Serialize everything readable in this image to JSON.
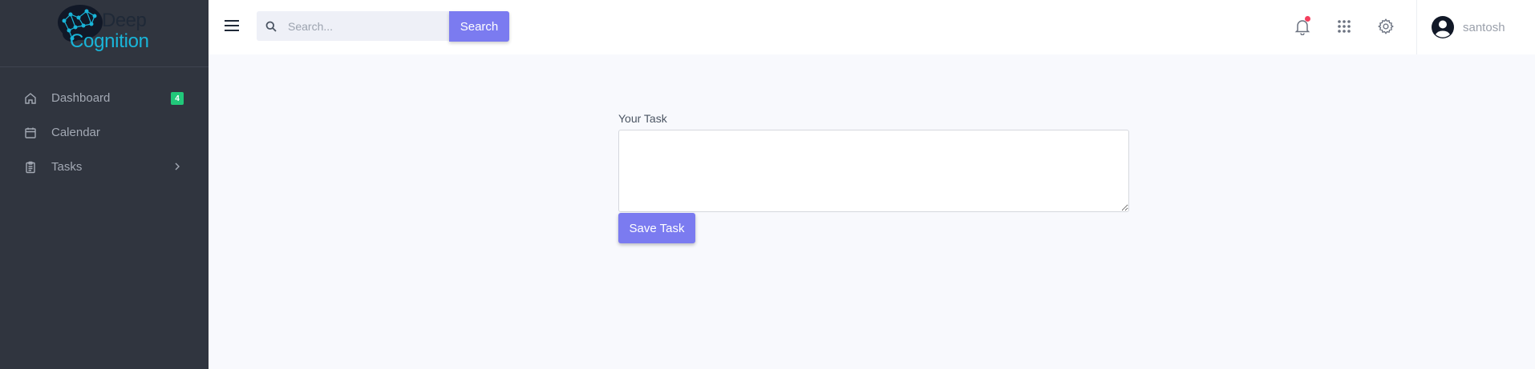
{
  "brand": {
    "line1": "Deep",
    "line2": "Cognition",
    "icon": "brain-network-logo",
    "colors": {
      "line1": "#1f2937",
      "line2": "#19b5d9"
    }
  },
  "sidebar": {
    "items": [
      {
        "label": "Dashboard",
        "icon": "home-icon",
        "badge": "4"
      },
      {
        "label": "Calendar",
        "icon": "calendar-icon"
      },
      {
        "label": "Tasks",
        "icon": "clipboard-icon",
        "expand_icon": "chevron-right-icon"
      }
    ]
  },
  "header": {
    "search": {
      "placeholder": "Search...",
      "value": "",
      "button_label": "Search"
    },
    "icons": [
      "menu-icon",
      "bell-icon",
      "apps-grid-icon",
      "gear-icon"
    ],
    "user": {
      "name": "santosh",
      "icon": "user-avatar-icon"
    }
  },
  "main": {
    "task_label": "Your Task",
    "task_value": "",
    "save_label": "Save Task"
  },
  "colors": {
    "sidebar_bg": "#30353f",
    "accent": "#7b7bf0",
    "badge": "#21c87a",
    "notification_dot": "#f43f5e",
    "content_bg": "#f8f9fd"
  }
}
